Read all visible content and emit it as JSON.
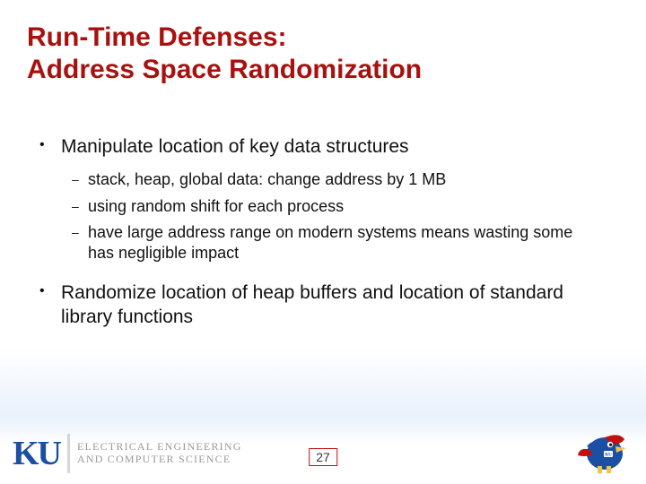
{
  "title": {
    "line1": "Run-Time Defenses:",
    "line2": "Address Space Randomization"
  },
  "bullets": [
    {
      "text": "Manipulate location of key data structures",
      "sub": [
        "stack, heap, global data: change address by 1 MB",
        "using random shift for each process",
        "have large address range on modern systems means wasting some has negligible impact"
      ]
    },
    {
      "text": "Randomize location of heap buffers and location of standard library functions",
      "sub": []
    }
  ],
  "footer": {
    "ku_mark": "KU",
    "dept_line1": "ELECTRICAL ENGINEERING",
    "dept_line2": "AND COMPUTER SCIENCE",
    "page_number": "27"
  },
  "colors": {
    "title": "#a8110e",
    "ku_blue": "#1a4fa3",
    "page_border": "#c01010"
  }
}
